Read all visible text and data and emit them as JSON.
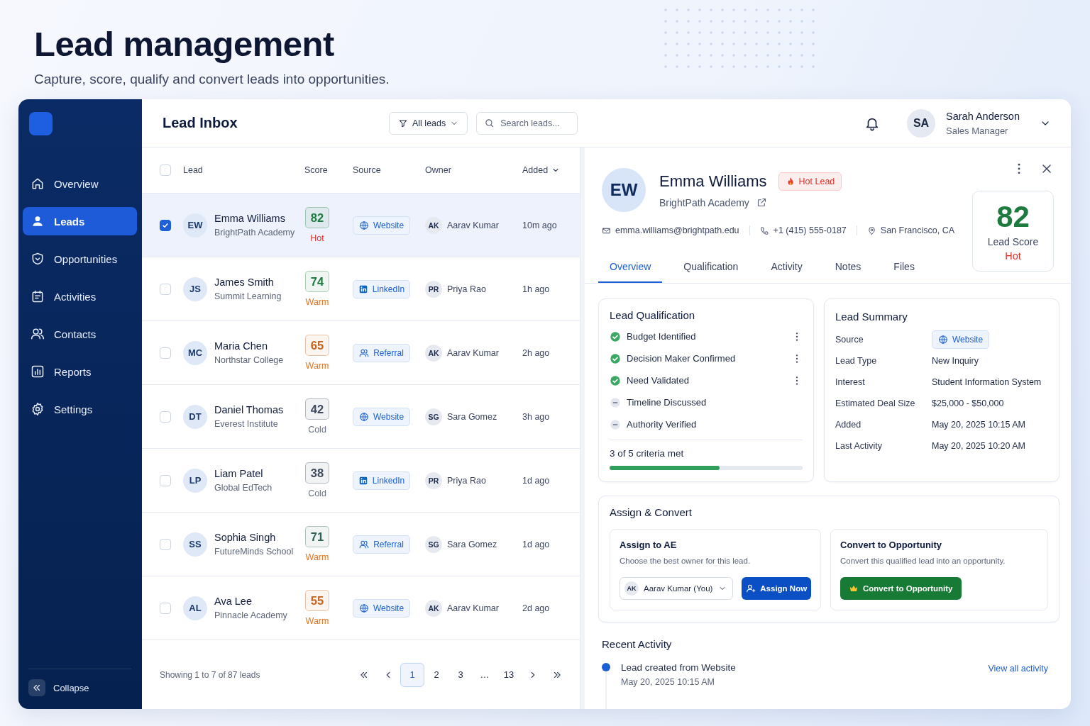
{
  "header": {
    "title": "Lead management",
    "subtitle": "Capture, score, qualify and convert leads into opportunities."
  },
  "sidebar": {
    "items": [
      {
        "label": "Overview",
        "selected": false
      },
      {
        "label": "Leads",
        "selected": true
      },
      {
        "label": "Opportunities",
        "selected": false
      },
      {
        "label": "Activities",
        "selected": false
      },
      {
        "label": "Contacts",
        "selected": false
      },
      {
        "label": "Reports",
        "selected": false
      },
      {
        "label": "Settings",
        "selected": false
      }
    ],
    "collapse": "Collapse"
  },
  "topbar": {
    "title": "Lead Inbox",
    "filter": "All leads",
    "search": {
      "placeholder": "Search leads..."
    },
    "user": {
      "initials": "SA",
      "name": "Sarah Anderson",
      "role": "Sales Manager"
    }
  },
  "inbox": {
    "select_all": {
      "checked": false
    },
    "columns": [
      {
        "label": "Lead",
        "sorted": false
      },
      {
        "label": "Score",
        "sorted": false
      },
      {
        "label": "Source",
        "sorted": false
      },
      {
        "label": "Owner",
        "sorted": false
      },
      {
        "label": "Added",
        "sorted": true
      }
    ],
    "rows": [
      {
        "checked": true,
        "selected": true,
        "initials": "EW",
        "name": "Emma Williams",
        "company": "BrightPath Academy",
        "score": {
          "value": "82",
          "color": "#1e7b3f"
        },
        "temperature": {
          "label": "Hot",
          "color": "#e0312b"
        },
        "source": {
          "kind": "website",
          "label": "Website"
        },
        "owner": {
          "initials": "AK",
          "name": "Aarav Kumar"
        },
        "added": "10m ago"
      },
      {
        "checked": false,
        "selected": false,
        "initials": "JS",
        "name": "James Smith",
        "company": "Summit Learning",
        "score": {
          "value": "74",
          "color": "#1e7b3f"
        },
        "temperature": {
          "label": "Warm",
          "color": "#e8741c"
        },
        "source": {
          "kind": "linkedin",
          "label": "LinkedIn"
        },
        "owner": {
          "initials": "PR",
          "name": "Priya Rao"
        },
        "added": "1h ago"
      },
      {
        "checked": false,
        "selected": false,
        "initials": "MC",
        "name": "Maria Chen",
        "company": "Northstar College",
        "score": {
          "value": "65",
          "color": "#c8621c"
        },
        "temperature": {
          "label": "Warm",
          "color": "#e8741c"
        },
        "source": {
          "kind": "referral",
          "label": "Referral"
        },
        "owner": {
          "initials": "AK",
          "name": "Aarav Kumar"
        },
        "added": "2h ago"
      },
      {
        "checked": false,
        "selected": false,
        "initials": "DT",
        "name": "Daniel Thomas",
        "company": "Everest Institute",
        "score": {
          "value": "42",
          "color": "#3f4a5e"
        },
        "temperature": {
          "label": "Cold",
          "color": "#6b7385"
        },
        "source": {
          "kind": "website",
          "label": "Website"
        },
        "owner": {
          "initials": "SG",
          "name": "Sara Gomez"
        },
        "added": "3h ago"
      },
      {
        "checked": false,
        "selected": false,
        "initials": "LP",
        "name": "Liam Patel",
        "company": "Global EdTech",
        "score": {
          "value": "38",
          "color": "#3f4a5e"
        },
        "temperature": {
          "label": "Cold",
          "color": "#6b7385"
        },
        "source": {
          "kind": "linkedin",
          "label": "LinkedIn"
        },
        "owner": {
          "initials": "PR",
          "name": "Priya Rao"
        },
        "added": "1d ago"
      },
      {
        "checked": false,
        "selected": false,
        "initials": "SS",
        "name": "Sophia Singh",
        "company": "FutureMinds School",
        "score": {
          "value": "71",
          "color": "#2d5f55"
        },
        "temperature": {
          "label": "Warm",
          "color": "#e8741c"
        },
        "source": {
          "kind": "referral",
          "label": "Referral"
        },
        "owner": {
          "initials": "SG",
          "name": "Sara Gomez"
        },
        "added": "1d ago"
      },
      {
        "checked": false,
        "selected": false,
        "initials": "AL",
        "name": "Ava Lee",
        "company": "Pinnacle Academy",
        "score": {
          "value": "55",
          "color": "#c8621c"
        },
        "temperature": {
          "label": "Warm",
          "color": "#e8741c"
        },
        "source": {
          "kind": "website",
          "label": "Website"
        },
        "owner": {
          "initials": "AK",
          "name": "Aarav Kumar"
        },
        "added": "2d ago"
      }
    ],
    "footer": {
      "summary": "Showing 1 to 7 of 87 leads",
      "pages": [
        {
          "label": "1",
          "selected": true
        },
        {
          "label": "2",
          "selected": false
        },
        {
          "label": "3",
          "selected": false
        },
        {
          "label": "…",
          "selected": false
        },
        {
          "label": "13",
          "selected": false
        }
      ]
    }
  },
  "detail": {
    "initials": "EW",
    "name": "Emma Williams",
    "badge": "Hot Lead",
    "company": "BrightPath Academy",
    "contacts": [
      {
        "kind": "email",
        "text": "emma.williams@brightpath.edu"
      },
      {
        "kind": "phone",
        "text": "+1 (415) 555-0187"
      },
      {
        "kind": "location",
        "text": "San Francisco, CA"
      }
    ],
    "score": {
      "value": "82",
      "label": "Lead Score",
      "temperature": "Hot"
    },
    "tabs": [
      {
        "label": "Overview",
        "selected": true
      },
      {
        "label": "Qualification",
        "selected": false
      },
      {
        "label": "Activity",
        "selected": false
      },
      {
        "label": "Notes",
        "selected": false
      },
      {
        "label": "Files",
        "selected": false
      }
    ],
    "qualification": {
      "title": "Lead Qualification",
      "criteria": [
        {
          "label": "Budget Identified",
          "met": true
        },
        {
          "label": "Decision Maker Confirmed",
          "met": true
        },
        {
          "label": "Need Validated",
          "met": true
        },
        {
          "label": "Timeline Discussed",
          "met": false
        },
        {
          "label": "Authority Verified",
          "met": false
        }
      ],
      "summary": "3 of 5 criteria met",
      "level": 0.57
    },
    "summary": {
      "title": "Lead Summary",
      "rows": [
        {
          "label": "Source",
          "value": "Website",
          "kind": "website"
        },
        {
          "label": "Lead Type",
          "value": "New Inquiry",
          "kind": "text"
        },
        {
          "label": "Interest",
          "value": "Student Information System",
          "kind": "text"
        },
        {
          "label": "Estimated Deal Size",
          "value": "$25,000 - $50,000",
          "kind": "text"
        },
        {
          "label": "Added",
          "value": "May 20, 2025 10:15 AM",
          "kind": "text"
        },
        {
          "label": "Last Activity",
          "value": "May 20, 2025 10:20 AM",
          "kind": "text"
        }
      ]
    },
    "assign_convert": {
      "title": "Assign & Convert",
      "assign": {
        "title": "Assign to AE",
        "description": "Choose the best owner for this lead.",
        "owner_initials": "AK",
        "owner": "Aarav Kumar (You)",
        "button": "Assign Now"
      },
      "convert": {
        "title": "Convert to Opportunity",
        "description": "Convert this qualified lead into an opportunity.",
        "button": "Convert to Opportunity"
      }
    },
    "recent_activity": {
      "title": "Recent Activity",
      "items": [
        {
          "text": "Lead created from Website",
          "time": "May 20, 2025 10:15 AM"
        }
      ],
      "link": "View all activity"
    }
  }
}
